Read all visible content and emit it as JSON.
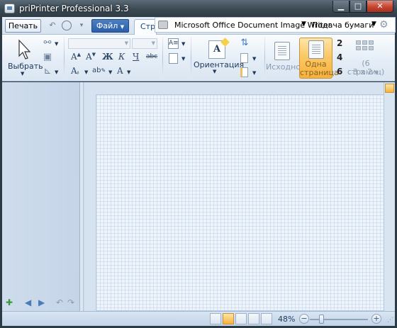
{
  "window": {
    "title": "priPrinter Professional 3.3",
    "minimize_glyph": "▁",
    "maximize_glyph": "□",
    "close_glyph": "✕"
  },
  "ribbon_top": {
    "print_label": "Печать",
    "file_label": "Файл",
    "page_tab_label": "Стра",
    "printer_name": "Microsoft Office Document Image Writer",
    "paper_feed_label": "Подача бумаги"
  },
  "ribbon": {
    "select_label": "Выбрать",
    "orientation_label": "Ориентация",
    "original_label": "Исходное",
    "one_page_line1": "Одна",
    "one_page_line2": "страница",
    "six_pages_line1": "(6 страниц)",
    "six_pages_line2": "3 x 2",
    "num_2": "2",
    "num_4": "4",
    "num_6": "6",
    "format_letters": [
      "A",
      "A",
      "Ж",
      "К",
      "Ч",
      "Ч",
      "abc"
    ]
  },
  "status": {
    "zoom_percent": "48%",
    "zoom_level_fraction": 0.2
  },
  "icons": {
    "binoculars": "binoculars-icon",
    "undo": "undo-icon",
    "settings": "gear-icon"
  }
}
